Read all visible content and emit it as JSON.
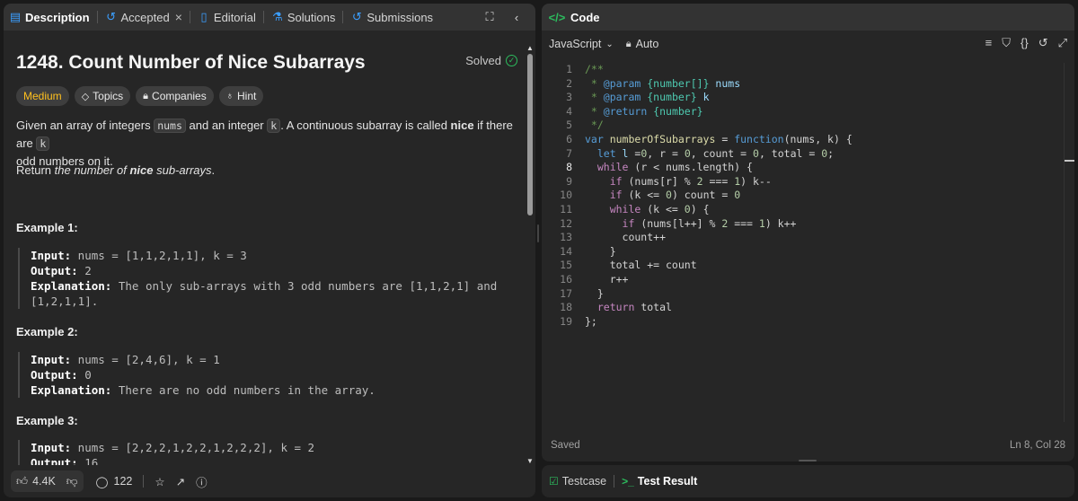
{
  "left_tabs": [
    {
      "label": "Description",
      "icon": "document-icon",
      "active": true
    },
    {
      "label": "Accepted",
      "icon": "history-icon",
      "closable": true
    },
    {
      "label": "Editorial",
      "icon": "book-icon"
    },
    {
      "label": "Solutions",
      "icon": "flask-icon"
    },
    {
      "label": "Submissions",
      "icon": "history-icon"
    }
  ],
  "problem": {
    "title": "1248. Count Number of Nice Subarrays",
    "status": "Solved",
    "difficulty": "Medium",
    "tags": [
      "Topics",
      "Companies",
      "Hint"
    ],
    "desc_a": "Given an array of integers ",
    "code_nums": "nums",
    "desc_b": " and an integer ",
    "code_k": "k",
    "desc_c": ". A continuous subarray is called ",
    "nice_word": "nice",
    "desc_d": " if there are ",
    "code_k2": "k",
    "desc_e": "odd numbers on it.",
    "return_a": "Return ",
    "return_b": "the number of ",
    "return_c": "nice",
    "return_d": " sub-arrays",
    "return_e": "."
  },
  "examples": [
    {
      "heading": "Example 1:",
      "input_label": "Input:",
      "input": " nums = [1,1,2,1,1], k = 3",
      "output_label": "Output:",
      "output": " 2",
      "expl_label": "Explanation:",
      "expl": " The only sub-arrays with 3 odd numbers are [1,1,2,1] and",
      "expl2": "[1,2,1,1]."
    },
    {
      "heading": "Example 2:",
      "input_label": "Input:",
      "input": " nums = [2,4,6], k = 1",
      "output_label": "Output:",
      "output": " 0",
      "expl_label": "Explanation:",
      "expl": " There are no odd numbers in the array."
    },
    {
      "heading": "Example 3:",
      "input_label": "Input:",
      "input": " nums = [2,2,2,1,2,2,1,2,2,2], k = 2",
      "output_label": "Output:",
      "output": " 16"
    }
  ],
  "footer": {
    "likes": "4.4K",
    "comments": "122"
  },
  "code_panel": {
    "tab_label": "Code",
    "language": "JavaScript",
    "mode": "Auto",
    "saved": "Saved",
    "cursor": "Ln 8, Col 28",
    "active_line": 8
  },
  "code_lines": [
    {
      "n": "1"
    },
    {
      "n": "2"
    },
    {
      "n": "3"
    },
    {
      "n": "4"
    },
    {
      "n": "5"
    },
    {
      "n": "6"
    },
    {
      "n": "7"
    },
    {
      "n": "8"
    },
    {
      "n": "9"
    },
    {
      "n": "10"
    },
    {
      "n": "11"
    },
    {
      "n": "12"
    },
    {
      "n": "13"
    },
    {
      "n": "14"
    },
    {
      "n": "15"
    },
    {
      "n": "16"
    },
    {
      "n": "17"
    },
    {
      "n": "18"
    },
    {
      "n": "19"
    }
  ],
  "code": {
    "l1": "/**",
    "l2a": " * ",
    "l2b": "@param",
    "l2c": " {number[]}",
    "l2d": " nums",
    "l3a": " * ",
    "l3b": "@param",
    "l3c": " {number}",
    "l3d": " k",
    "l4a": " * ",
    "l4b": "@return",
    "l4c": " {number}",
    "l5": " */",
    "l6a": "var ",
    "l6b": "numberOfSubarrays",
    "l6c": " = ",
    "l6d": "function",
    "l6e": "(nums, k) {",
    "l7a": "  let ",
    "l7b": "l",
    "l7c": " =",
    "l7d": "0",
    "l7e": ", r = ",
    "l7f": "0",
    "l7g": ", count = ",
    "l7h": "0",
    "l7i": ", total = ",
    "l7j": "0",
    "l7k": ";",
    "l8a": "  while",
    "l8b": " (r < nums.length) {",
    "l9a": "    if",
    "l9b": " (nums[r] % ",
    "l9c": "2",
    "l9d": " === ",
    "l9e": "1",
    "l9f": ") k--",
    "l10a": "    if",
    "l10b": " (k <= ",
    "l10c": "0",
    "l10d": ") count = ",
    "l10e": "0",
    "l11a": "    while",
    "l11b": " (k <= ",
    "l11c": "0",
    "l11d": ") {",
    "l12a": "      if",
    "l12b": " (nums[l++] % ",
    "l12c": "2",
    "l12d": " === ",
    "l12e": "1",
    "l12f": ") k++",
    "l13": "      count++",
    "l14": "    }",
    "l15": "    total += count",
    "l16": "    r++",
    "l17": "  }",
    "l18a": "  return",
    "l18b": " total",
    "l19": "};"
  },
  "bottom_tabs": [
    {
      "label": "Testcase",
      "icon": "checkbox-icon"
    },
    {
      "label": "Test Result",
      "icon": "terminal-icon",
      "active": true
    }
  ],
  "colors": {
    "accent_green": "#2cbb5d",
    "medium": "#ffc01e",
    "bg": "#1a1a1a",
    "panel": "#262626"
  }
}
